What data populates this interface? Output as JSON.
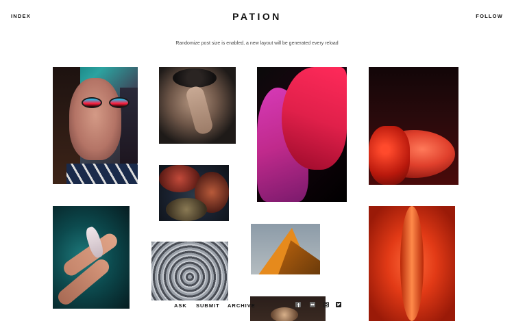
{
  "header": {
    "index_label": "INDEX",
    "title": "PATION",
    "follow_label": "FOLLOW"
  },
  "notice": "Randomize post size is enabled, a new layout will be generated every reload",
  "footer": {
    "ask_label": "ASK",
    "submit_label": "SUBMIT",
    "archive_label": "ARCHIVE",
    "icons": [
      "facebook-icon",
      "flickr-icon",
      "instagram-icon",
      "twitter-icon"
    ]
  },
  "colors": {
    "background": "#ffffff",
    "text": "#111111",
    "notice_text": "#444444"
  }
}
